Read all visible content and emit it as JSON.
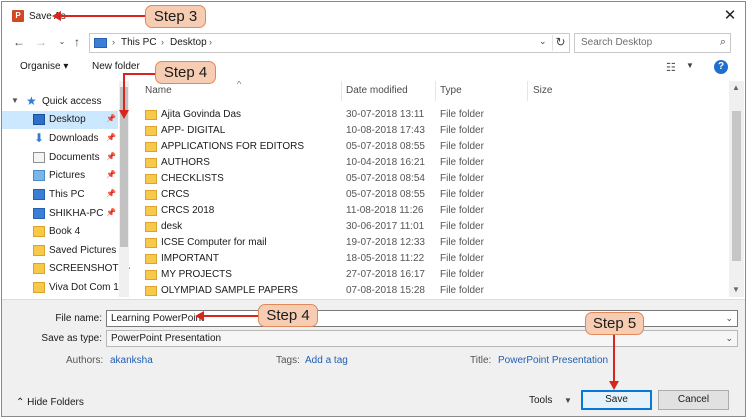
{
  "window": {
    "title": "Save As",
    "app_icon": "powerpoint-icon"
  },
  "nav": {
    "back_icon": "arrow-left-icon",
    "forward_icon": "arrow-right-icon",
    "recent_icon": "chevron-down-icon",
    "up_icon": "arrow-up-icon",
    "breadcrumbs": [
      "This PC",
      "Desktop"
    ],
    "search_placeholder": "Search Desktop"
  },
  "toolbar": {
    "organise": "Organise ▾",
    "new_folder": "New folder"
  },
  "sidebar": {
    "quick_access": "Quick access",
    "items": [
      {
        "label": "Desktop",
        "icon": "desktop-icon",
        "pinned": true,
        "selected": true
      },
      {
        "label": "Downloads",
        "icon": "download-icon",
        "pinned": true
      },
      {
        "label": "Documents",
        "icon": "documents-icon",
        "pinned": true
      },
      {
        "label": "Pictures",
        "icon": "pictures-icon",
        "pinned": true
      },
      {
        "label": "This PC",
        "icon": "computer-icon",
        "pinned": true
      },
      {
        "label": "SHIKHA-PC",
        "icon": "computer-icon",
        "pinned": true
      },
      {
        "label": "Book 4",
        "icon": "folder-icon"
      },
      {
        "label": "Saved Pictures",
        "icon": "folder-icon"
      },
      {
        "label": "SCREENSHOTS -",
        "icon": "folder-icon"
      },
      {
        "label": "Viva Dot Com 1 -",
        "icon": "folder-icon"
      }
    ]
  },
  "columns": {
    "name": "Name",
    "date": "Date modified",
    "type": "Type",
    "size": "Size"
  },
  "files": [
    {
      "name": "Ajita Govinda Das",
      "date": "30-07-2018 13:11",
      "type": "File folder"
    },
    {
      "name": "APP- DIGITAL",
      "date": "10-08-2018 17:43",
      "type": "File folder"
    },
    {
      "name": "APPLICATIONS FOR EDITORS",
      "date": "05-07-2018 08:55",
      "type": "File folder"
    },
    {
      "name": "AUTHORS",
      "date": "10-04-2018 16:21",
      "type": "File folder"
    },
    {
      "name": "CHECKLISTS",
      "date": "05-07-2018 08:54",
      "type": "File folder"
    },
    {
      "name": "CRCS",
      "date": "05-07-2018 08:55",
      "type": "File folder"
    },
    {
      "name": "CRCS 2018",
      "date": "11-08-2018 11:26",
      "type": "File folder"
    },
    {
      "name": "desk",
      "date": "30-06-2017 11:01",
      "type": "File folder"
    },
    {
      "name": "ICSE Computer for mail",
      "date": "19-07-2018 12:33",
      "type": "File folder"
    },
    {
      "name": "IMPORTANT",
      "date": "18-05-2018 11:22",
      "type": "File folder"
    },
    {
      "name": "MY PROJECTS",
      "date": "27-07-2018 16:17",
      "type": "File folder"
    },
    {
      "name": "OLYMPIAD SAMPLE PAPERS",
      "date": "07-08-2018 15:28",
      "type": "File folder"
    }
  ],
  "form": {
    "file_name_label": "File name:",
    "file_name_value": "Learning PowerPoint",
    "save_type_label": "Save as type:",
    "save_type_value": "PowerPoint Presentation",
    "authors_label": "Authors:",
    "authors_value": "akanksha",
    "tags_label": "Tags:",
    "tags_value": "Add a tag",
    "title_label": "Title:",
    "title_value": "PowerPoint Presentation"
  },
  "footer": {
    "hide_folders": "Hide Folders",
    "tools": "Tools",
    "save": "Save",
    "cancel": "Cancel"
  },
  "annotations": {
    "step3": "Step 3",
    "step4a": "Step 4",
    "step4b": "Step 4",
    "step5": "Step 5",
    "arrow_color": "#d8251d",
    "callout_color": "#f6cdb3"
  }
}
